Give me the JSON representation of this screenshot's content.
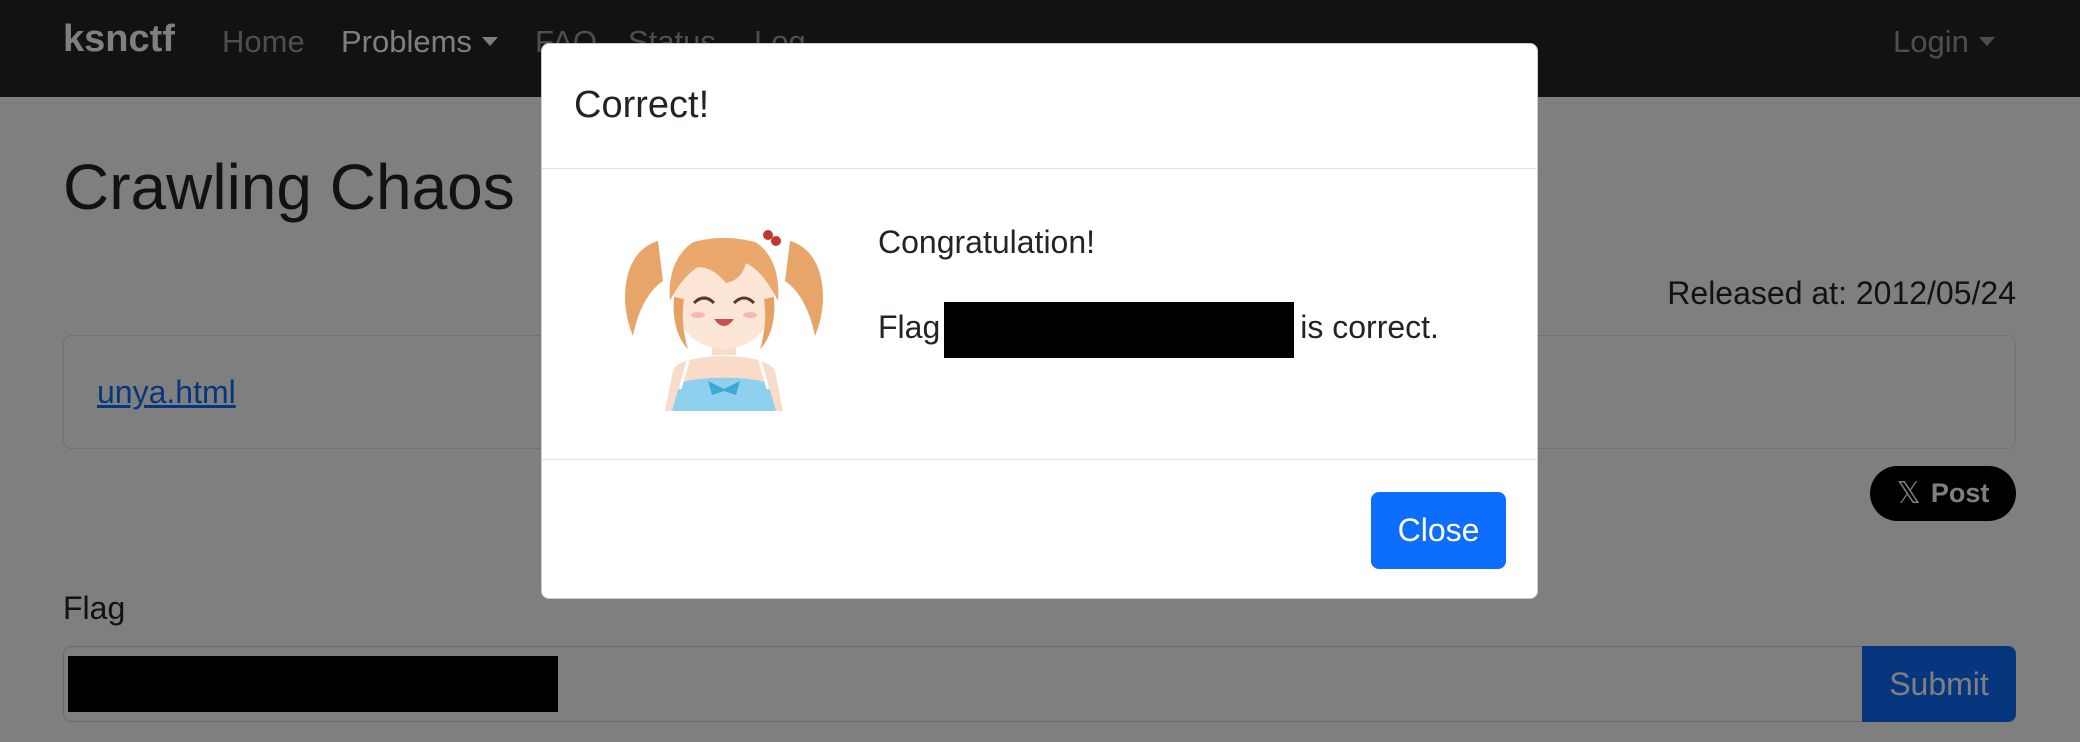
{
  "navbar": {
    "brand": "ksnctf",
    "items": [
      {
        "label": "Home"
      },
      {
        "label": "Problems"
      },
      {
        "label": "FAQ"
      },
      {
        "label": "Status"
      },
      {
        "label": "Log"
      }
    ],
    "login": "Login"
  },
  "problem": {
    "title": "Crawling Chaos",
    "released": "Released at: 2012/05/24",
    "file_link": "unya.html",
    "post_label": "Post",
    "flag_label": "Flag",
    "submit_label": "Submit"
  },
  "modal": {
    "title": "Correct!",
    "congrats": "Congratulation!",
    "flag_prefix": "Flag",
    "flag_suffix": "is correct.",
    "close_label": "Close"
  },
  "colors": {
    "navbar_bg": "#212529",
    "primary": "#0d6efd",
    "backdrop": "rgba(0,0,0,0.5)"
  }
}
